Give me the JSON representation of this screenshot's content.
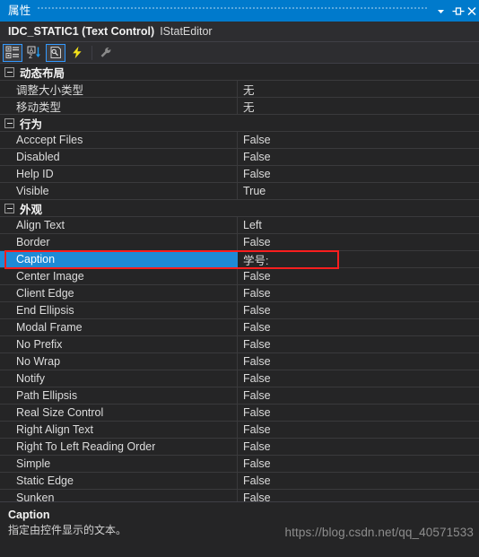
{
  "titlebar": {
    "title": "属性",
    "buttons": [
      {
        "name": "window-menu-dropdown",
        "icon": "chevron-down-icon",
        "label": "▾"
      },
      {
        "name": "auto-hide-pin",
        "icon": "pin-icon",
        "label": "⊣⊢"
      },
      {
        "name": "close-panel",
        "icon": "close-icon",
        "label": "✕"
      }
    ]
  },
  "object_header": {
    "object_name": "IDC_STATIC1 (Text Control)",
    "editor_name": "IStatEditor"
  },
  "toolbar": {
    "buttons": [
      {
        "name": "categorized-view",
        "icon": "categorized-list-icon",
        "active": true
      },
      {
        "name": "alphabetical-view",
        "icon": "sort-alpha-icon",
        "active": false
      },
      {
        "name": "properties-page",
        "icon": "property-page-icon",
        "active": true
      },
      {
        "name": "events-view",
        "icon": "lightning-bolt-icon",
        "active": false
      },
      {
        "name": "property-settings",
        "icon": "wrench-icon",
        "active": false
      }
    ]
  },
  "grid": {
    "rows": [
      {
        "kind": "category",
        "name": "动态布局"
      },
      {
        "kind": "prop",
        "name": "调整大小类型",
        "value": "无"
      },
      {
        "kind": "prop",
        "name": "移动类型",
        "value": "无"
      },
      {
        "kind": "category",
        "name": "行为"
      },
      {
        "kind": "prop",
        "name": "Acccept Files",
        "value": "False"
      },
      {
        "kind": "prop",
        "name": "Disabled",
        "value": "False"
      },
      {
        "kind": "prop",
        "name": "Help ID",
        "value": "False"
      },
      {
        "kind": "prop",
        "name": "Visible",
        "value": "True"
      },
      {
        "kind": "category",
        "name": "外观"
      },
      {
        "kind": "prop",
        "name": "Align Text",
        "value": "Left"
      },
      {
        "kind": "prop",
        "name": "Border",
        "value": "False"
      },
      {
        "kind": "prop",
        "name": "Caption",
        "value": "学号:",
        "selected": true,
        "annotated": true
      },
      {
        "kind": "prop",
        "name": "Center Image",
        "value": "False"
      },
      {
        "kind": "prop",
        "name": "Client Edge",
        "value": "False"
      },
      {
        "kind": "prop",
        "name": "End Ellipsis",
        "value": "False"
      },
      {
        "kind": "prop",
        "name": "Modal Frame",
        "value": "False"
      },
      {
        "kind": "prop",
        "name": "No Prefix",
        "value": "False"
      },
      {
        "kind": "prop",
        "name": "No Wrap",
        "value": "False"
      },
      {
        "kind": "prop",
        "name": "Notify",
        "value": "False"
      },
      {
        "kind": "prop",
        "name": "Path Ellipsis",
        "value": "False"
      },
      {
        "kind": "prop",
        "name": "Real Size Control",
        "value": "False"
      },
      {
        "kind": "prop",
        "name": "Right Align Text",
        "value": "False"
      },
      {
        "kind": "prop",
        "name": "Right To Left Reading Order",
        "value": "False"
      },
      {
        "kind": "prop",
        "name": "Simple",
        "value": "False"
      },
      {
        "kind": "prop",
        "name": "Static Edge",
        "value": "False"
      },
      {
        "kind": "prop",
        "name": "Sunken",
        "value": "False",
        "clipped": true
      }
    ]
  },
  "description": {
    "title": "Caption",
    "text": "指定由控件显示的文本。"
  },
  "watermark": "https://blog.csdn.net/qq_40571533",
  "colors": {
    "titlebar_bg": "#007acc",
    "panel_bg": "#252526",
    "header_bg": "#2d2d30",
    "selection_blue": "#1e8ad6",
    "annotation_red": "#fa1e1e",
    "text_primary": "#dcdcdc",
    "bolt_yellow": "#f2e01a"
  }
}
